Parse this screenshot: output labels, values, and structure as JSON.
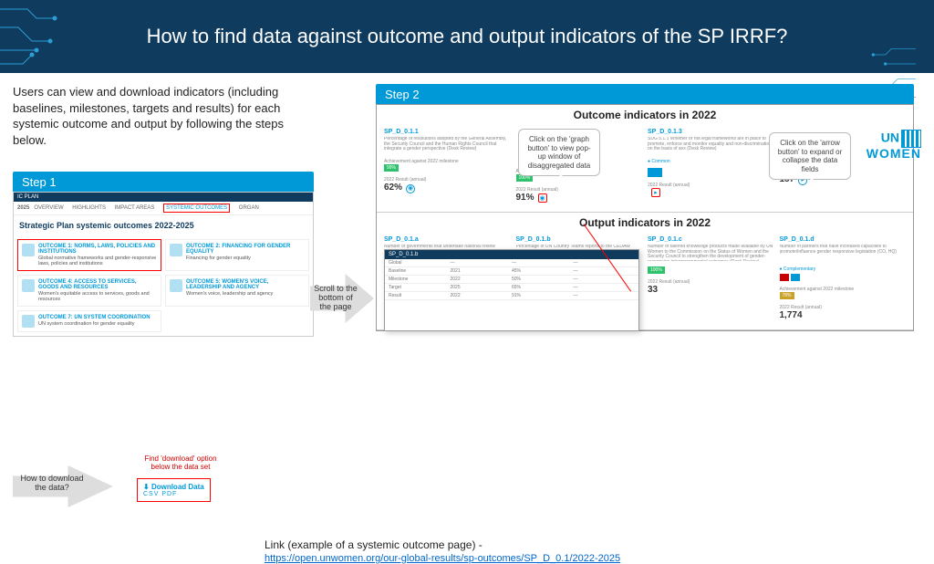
{
  "header": {
    "title": "How to find data against outcome and output indicators of the SP IRRF?"
  },
  "intro": "Users can view and download indicators (including baselines, milestones, targets and results) for each systemic outcome and output by following the steps below.",
  "step1": {
    "label": "Step 1",
    "topbar_left": "IC PLAN",
    "topbar_year": "2025",
    "nav": {
      "a": "OVERVIEW",
      "b": "HIGHLIGHTS",
      "c": "IMPACT AREAS",
      "d": "SYSTEMIC OUTCOMES",
      "e": "ORGAN"
    },
    "heading": "Strategic Plan systemic outcomes 2022-2025",
    "cards": [
      {
        "t": "OUTCOME 1: NORMS, LAWS, POLICIES AND INSTITUTIONS",
        "d": "Global normative frameworks and gender-responsive laws, policies and institutions"
      },
      {
        "t": "OUTCOME 2: FINANCING FOR GENDER EQUALITY",
        "d": "Financing for gender equality"
      },
      {
        "t": "OUTCOME 4: ACCESS TO SERVICES, GOODS AND RESOURCES",
        "d": "Women's equitable access to services, goods and resources"
      },
      {
        "t": "OUTCOME 5: WOMEN'S VOICE, LEADERSHIP AND AGENCY",
        "d": "Women's voice, leadership and agency"
      },
      {
        "t": "OUTCOME 7: UN SYSTEM COORDINATION",
        "d": "UN system coordination for gender equality"
      }
    ]
  },
  "arrow1": "Scroll to the bottom of the page",
  "step2": {
    "label": "Step 2",
    "section_a_title": "Outcome indicators in 2022",
    "section_b_title": "Output indicators in 2022",
    "callout_graph": "Click on the 'graph button' to view pop-up window of disaggregated data",
    "callout_arrow": "Click on the 'arrow button' to expand or collapse the data fields",
    "outcome_cards": [
      {
        "code": "SP_D_0.1.1",
        "desc": "Percentage of resolutions adopted by the General Assembly, the Security Council and the Human Rights Council that integrate a gender perspective (Desk Review)",
        "val": "62%"
      },
      {
        "code": "",
        "desc": "",
        "val": "91%"
      },
      {
        "code": "SP_D_0.1.3",
        "desc": "SDG 5.1.1 Whether or not legal frameworks are in place to promote, enforce and monitor equality and non-discrimination on the basis of sex (Desk Review)",
        "val": ""
      },
      {
        "code": "",
        "desc": "",
        "val": "157"
      }
    ],
    "output_cards": [
      {
        "code": "SP_D_0.1.a",
        "desc": "Number of governments that undertake national review",
        "val": ""
      },
      {
        "code": "SP_D_0.1.b",
        "desc": "Percentage of UN Country Teams reports to the CEDAW Committee",
        "val": ""
      },
      {
        "code": "SP_D_0.1.c",
        "desc": "Number of tailored knowledge products made available by UN Women to the Commission on the Status of Women and the Security Council to strengthen the development of gender-responsive intergovernmental outcomes (Desk Review)",
        "val": "33"
      },
      {
        "code": "SP_D_0.1.d",
        "desc": "Number of partners that have increased capacities to promote/influence gender responsive legislation (CO, HQ)",
        "val": "1,774",
        "comp": "Complementary"
      }
    ],
    "popup_header": "SP_D_0.1.b",
    "ach_label": "Achievement against 2022 milestone",
    "res_label": "2022 Result (annual)"
  },
  "howto": {
    "arrow": "How to download the data?",
    "note": "Find 'download' option below the data set",
    "dl_title": "Download Data",
    "dl_formats": "CSV  PDF"
  },
  "link": {
    "prefix": "Link (example of a systemic outcome page) - ",
    "url": "https://open.unwomen.org/our-global-results/sp-outcomes/SP_D_0.1/2022-2025"
  },
  "logo": {
    "l1": "UN",
    "l2": "WOMEN"
  }
}
